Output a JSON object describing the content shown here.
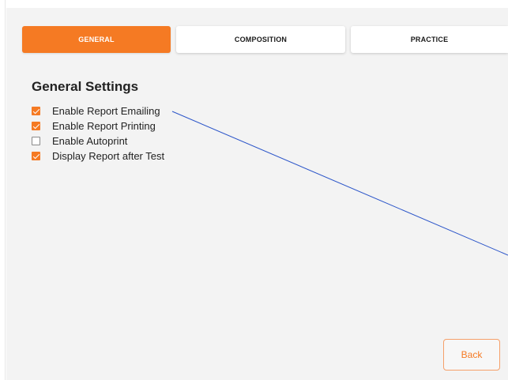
{
  "tabs": [
    {
      "label": "GENERAL",
      "active": true
    },
    {
      "label": "COMPOSITION",
      "active": false
    },
    {
      "label": "PRACTICE",
      "active": false
    }
  ],
  "section": {
    "title": "General Settings"
  },
  "settings": [
    {
      "label": "Enable Report Emailing",
      "checked": true
    },
    {
      "label": "Enable Report Printing",
      "checked": true
    },
    {
      "label": "Enable Autoprint",
      "checked": false
    },
    {
      "label": "Display Report after Test",
      "checked": true
    }
  ],
  "footer": {
    "back_label": "Back"
  },
  "colors": {
    "accent": "#f57a23",
    "panel_background": "#f3f3f3",
    "connector_line": "#2b55c9"
  }
}
